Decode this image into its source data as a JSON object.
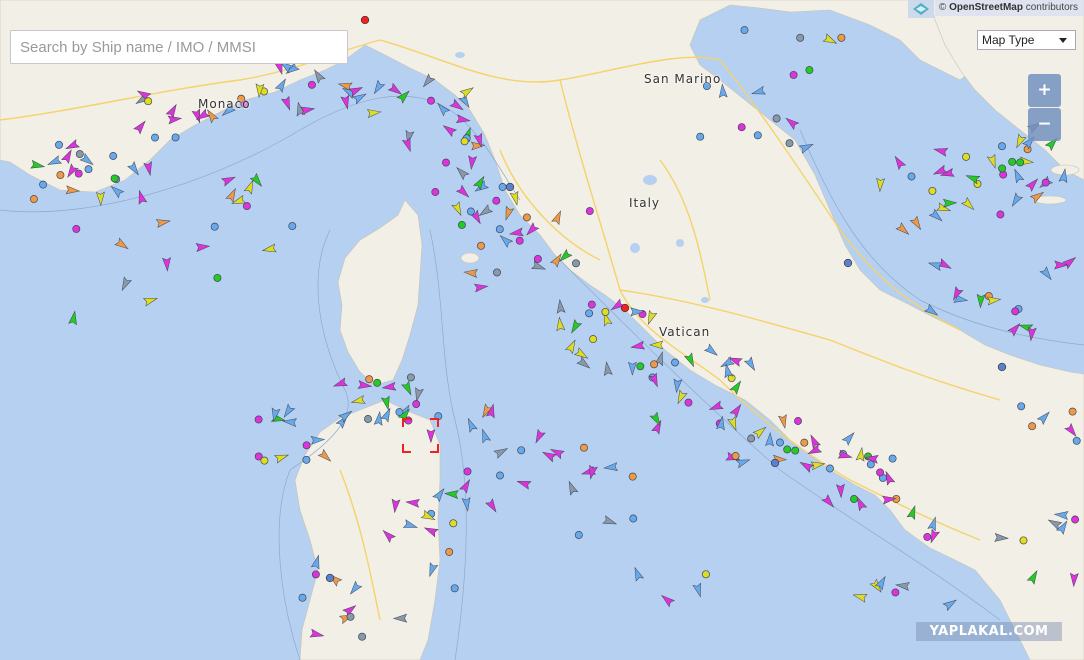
{
  "search": {
    "placeholder": "Search by Ship name / IMO / MMSI"
  },
  "map_type": {
    "label": "Map Type",
    "caret_icon": "chevron-down-icon"
  },
  "zoom": {
    "in_label": "+",
    "out_label": "−"
  },
  "attribution": {
    "symbol": "©",
    "source": "OpenStreetMap",
    "suffix": "contributors",
    "logo_icon": "layers-diamond-icon"
  },
  "watermark": {
    "text": "YAPLAKAL.COM"
  },
  "places": {
    "san_marino": "San Marino",
    "italy": "Italy",
    "vatican": "Vatican",
    "monaco": "Monaco"
  },
  "colors": {
    "sea": "#b5d0f0",
    "land": "#f2efe6",
    "road": "#f5d26a",
    "passenger": "#dd33dd",
    "cargo": "#66aaee",
    "tanker": "#dddd22",
    "fishing": "#ee9944",
    "tug": "#22cc22",
    "other": "#8899aa",
    "port": "#5b82c8",
    "selected": "#ee2222"
  }
}
